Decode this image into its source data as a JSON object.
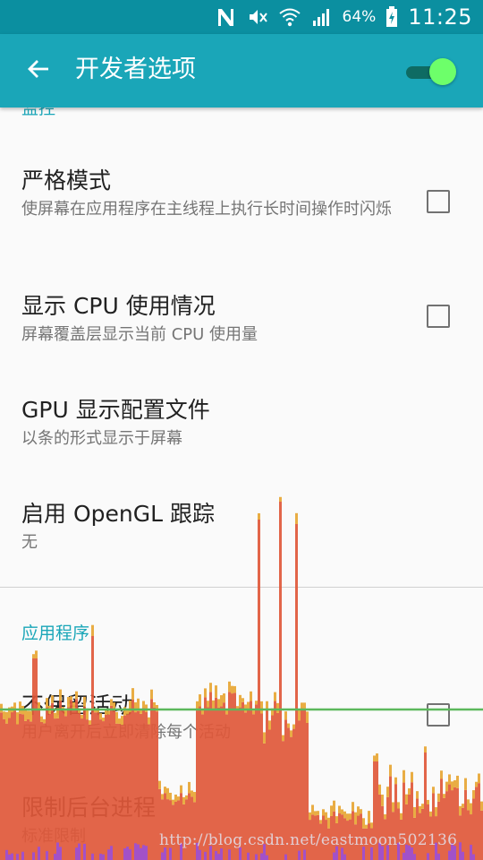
{
  "status_bar": {
    "icons": [
      "notification-n-icon",
      "mute-icon",
      "wifi-icon",
      "signal-icon",
      "battery-charging-icon"
    ],
    "battery": "64%",
    "time": "11:25"
  },
  "app_bar": {
    "title": "开发者选项",
    "back_icon": "arrow-back-icon",
    "switch_on": true,
    "switch_color": "#6dff6a"
  },
  "sections": {
    "monitoring_header": "监控",
    "apps_header": "应用程序"
  },
  "preferences": {
    "strict_mode": {
      "title": "严格模式",
      "summary": "使屏幕在应用程序在主线程上执行长时间操作时闪烁",
      "checked": false
    },
    "show_cpu": {
      "title": "显示 CPU 使用情况",
      "summary": "屏幕覆盖层显示当前 CPU 使用量",
      "checked": false
    },
    "gpu_profile": {
      "title": "GPU 显示配置文件",
      "summary": "以条的形式显示于屏幕"
    },
    "opengl_trace": {
      "title": "启用 OpenGL 跟踪",
      "summary": "无"
    },
    "dont_keep": {
      "title": "不保留活动",
      "summary": "用户离开后立即清除每个活动",
      "checked": false
    },
    "bg_limit": {
      "title": "限制后台进程",
      "summary": "标准限制"
    }
  },
  "watermark": "http://blog.csdn.net/eastmoon502136",
  "colors": {
    "status_bar": "#0b8fa0",
    "app_bar": "#1aa6b8",
    "accent": "#1aa6b8",
    "bar_main": "#e0583a",
    "bar_top": "#e8a93a",
    "bar_low": "#9b4fd6",
    "threshold_line": "#5cb85c"
  }
}
